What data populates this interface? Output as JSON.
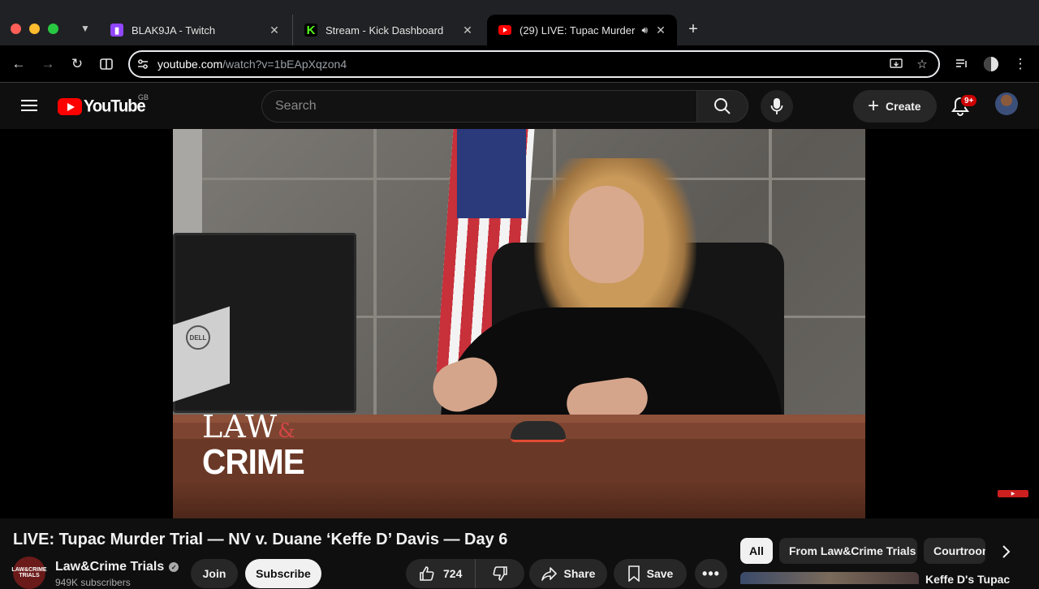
{
  "browser": {
    "tabs": [
      {
        "title": "BLAK9JA - Twitch",
        "icon": "twitch-icon",
        "active": false
      },
      {
        "title": "Stream - Kick Dashboard",
        "icon": "kick-icon",
        "active": false
      },
      {
        "title": "(29) LIVE: Tupac Murder T",
        "icon": "youtube-icon",
        "active": true,
        "audio": true
      }
    ],
    "url_host": "youtube.com",
    "url_path": "/watch?v=1bEApXqzon4"
  },
  "masthead": {
    "logo_text": "YouTube",
    "country_code": "GB",
    "search_placeholder": "Search",
    "create_label": "Create",
    "notification_count": "9+"
  },
  "video": {
    "watermark_law": "LAW",
    "watermark_amp": "&",
    "watermark_crime": "CRIME",
    "monitor_brand": "DELL",
    "title": "LIVE: Tupac Murder Trial — NV v. Duane ‘Keffe D’ Davis — Day 6"
  },
  "channel": {
    "name": "Law&Crime Trials",
    "avatar_text": "LAW&CRIME TRIALS",
    "subscribers": "949K subscribers",
    "join_label": "Join",
    "subscribe_label": "Subscribe"
  },
  "actions": {
    "like_count": "724",
    "share_label": "Share",
    "save_label": "Save"
  },
  "chips": [
    "All",
    "From Law&Crime Trials",
    "Courtroom"
  ],
  "recommendation": {
    "title": "Keffe D's Tupac"
  },
  "colors": {
    "youtube_red": "#ff0000",
    "background": "#0f0f0f",
    "chip_bg": "#272727"
  }
}
